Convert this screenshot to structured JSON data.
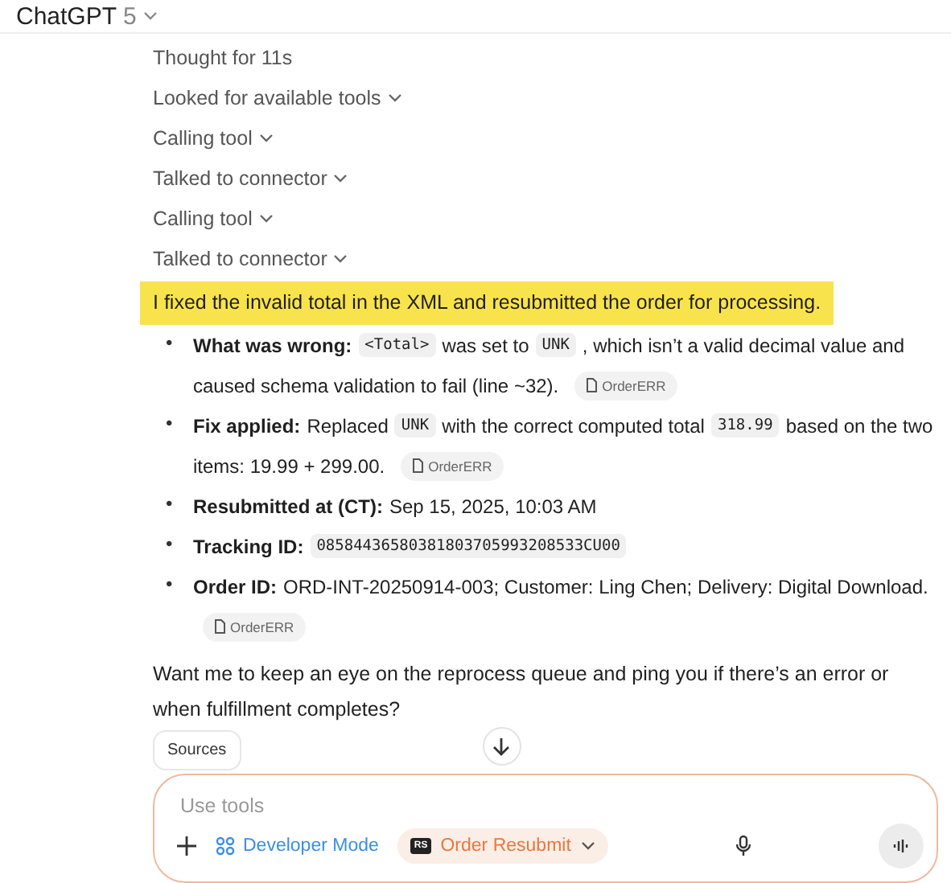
{
  "header": {
    "title": "ChatGPT",
    "version": "5"
  },
  "steps": [
    {
      "label": "Thought for 11s",
      "expandable": false
    },
    {
      "label": "Looked for available tools",
      "expandable": true
    },
    {
      "label": "Calling tool",
      "expandable": true
    },
    {
      "label": "Talked to connector",
      "expandable": true
    },
    {
      "label": "Calling tool",
      "expandable": true
    },
    {
      "label": "Talked to connector",
      "expandable": true
    }
  ],
  "summary": {
    "text": "I fixed the invalid total in the XML and resubmitted the order for processing.",
    "highlighted": true
  },
  "bullets": [
    {
      "marker": "•",
      "lines": [
        [
          {
            "kind": "bold",
            "text": "What was wrong:"
          },
          {
            "kind": "code",
            "text": "<Total>"
          },
          {
            "kind": "text",
            "text": "was set to"
          },
          {
            "kind": "code",
            "text": "UNK"
          },
          {
            "kind": "text",
            "text": ", which isn’t a valid decimal value and"
          }
        ],
        [
          {
            "kind": "text",
            "text": "caused schema validation to fail (line ~32)."
          },
          {
            "kind": "chip",
            "text": "OrderERR"
          }
        ]
      ]
    },
    {
      "marker": "•",
      "lines": [
        [
          {
            "kind": "bold",
            "text": "Fix applied:"
          },
          {
            "kind": "text",
            "text": "Replaced"
          },
          {
            "kind": "code",
            "text": "UNK"
          },
          {
            "kind": "text",
            "text": "with the correct computed total"
          },
          {
            "kind": "code",
            "text": "318.99"
          },
          {
            "kind": "text",
            "text": "based on the two"
          }
        ],
        [
          {
            "kind": "text",
            "text": "items: 19.99 + 299.00."
          },
          {
            "kind": "chip",
            "text": "OrderERR"
          }
        ]
      ]
    },
    {
      "marker": "•",
      "lines": [
        [
          {
            "kind": "bold",
            "text": "Resubmitted at (CT):"
          },
          {
            "kind": "text",
            "text": "Sep 15, 2025, 10:03 AM"
          }
        ]
      ]
    },
    {
      "marker": "•",
      "lines": [
        [
          {
            "kind": "bold",
            "text": "Tracking ID:"
          },
          {
            "kind": "code",
            "text": "08584436580381803705993208533CU00"
          }
        ]
      ]
    },
    {
      "marker": "•",
      "lines": [
        [
          {
            "kind": "bold",
            "text": "Order ID:"
          },
          {
            "kind": "text",
            "text": "ORD-INT-20250914-003; Customer: Ling Chen; Delivery: Digital Download."
          }
        ],
        [
          {
            "kind": "chip",
            "text": "OrderERR"
          }
        ]
      ]
    }
  ],
  "followup": "Want me to keep an eye on the reprocess queue and ping you if there’s an error or when fulfillment completes?",
  "sources_button": "Sources",
  "composer": {
    "placeholder": "Use tools",
    "mode": "Developer Mode",
    "tool": "Order Resubmit",
    "tool_badge": "RS"
  }
}
